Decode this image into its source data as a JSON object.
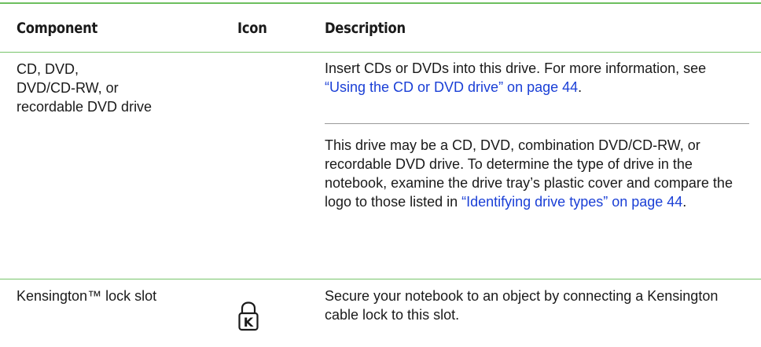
{
  "header": {
    "component": "Component",
    "icon": "Icon",
    "description": "Description"
  },
  "rows": [
    {
      "component_lines": [
        "CD, DVD,",
        "DVD/CD-RW, or",
        "recordable DVD drive"
      ],
      "icon": "",
      "paragraphs": [
        {
          "text_before": "Insert CDs or DVDs into this drive. For more information, see ",
          "link": "“Using the CD or DVD drive” on page 44",
          "text_after": "."
        },
        {
          "text_before": "This drive may be a CD, DVD, combination DVD/CD-RW, or recordable DVD drive. To determine the type of drive in the notebook, examine the drive tray’s plastic cover and compare the logo to those listed in ",
          "link": "“Identifying drive types” on page 44",
          "text_after": "."
        }
      ]
    },
    {
      "component_lines": [
        "Kensington™ lock slot"
      ],
      "icon": "kensington-lock-icon",
      "icon_letter": "K",
      "paragraphs": [
        {
          "text_before": "Secure your notebook to an object by connecting a Kensington cable lock to this slot.",
          "link": "",
          "text_after": ""
        }
      ]
    }
  ],
  "colors": {
    "rule": "#6dbf5f",
    "link": "#1a3fd6",
    "text": "#1a1a1a"
  }
}
